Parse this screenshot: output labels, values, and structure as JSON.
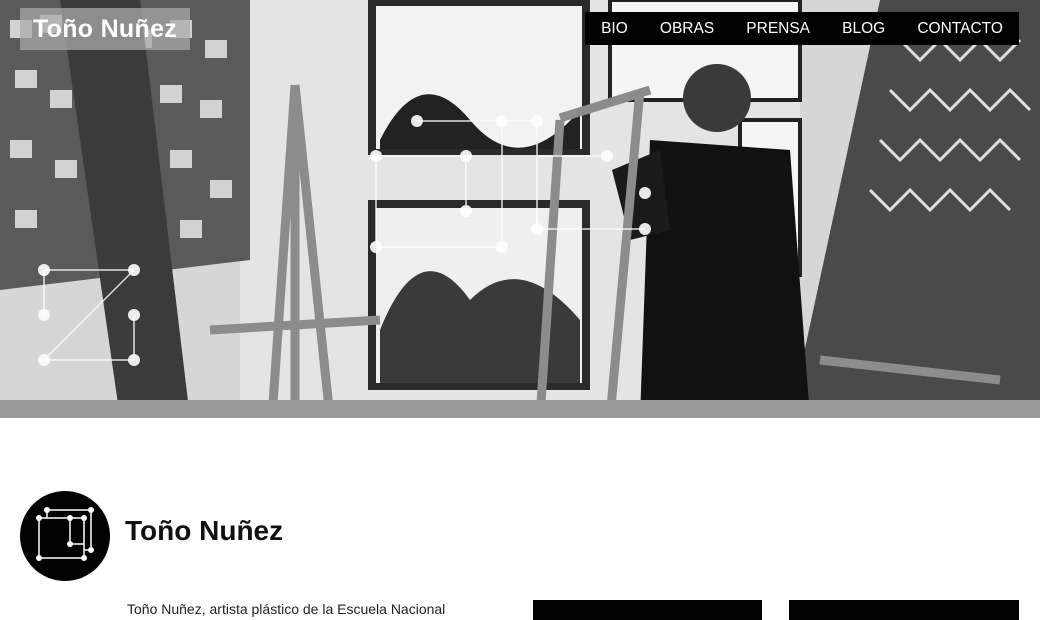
{
  "site": {
    "logo_text": "Toño Nuñez"
  },
  "nav": {
    "items": [
      "BIO",
      "OBRAS",
      "PRENSA",
      "BLOG",
      "CONTACTO"
    ]
  },
  "profile": {
    "name": "Toño Nuñez",
    "bio_snippet": "Toño Nuñez, artista plástico de la Escuela Nacional"
  },
  "colors": {
    "nav_bg": "#000000",
    "nav_text": "#ffffff",
    "logo_bg": "#aaaaaa",
    "text": "#111111"
  },
  "icons": {
    "avatar": "cube-outline-icon"
  }
}
